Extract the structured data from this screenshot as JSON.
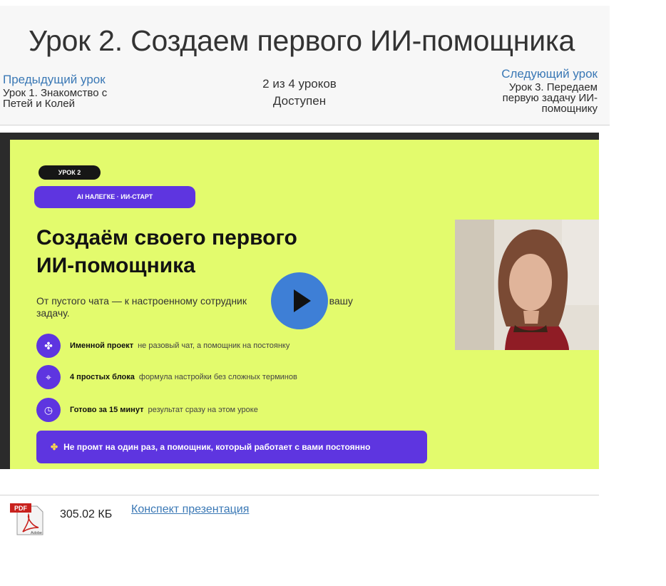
{
  "lesson": {
    "title": "Урок 2. Создаем первого ИИ-помощника"
  },
  "nav": {
    "prev_label": "Предыдущий урок",
    "prev_title_line1": "Урок 1. Знакомство с",
    "prev_title_line2": "Петей и Колей",
    "progress": "2 из 4 уроков",
    "status": "Доступен",
    "next_label": "Следующий урок",
    "next_title_line1": "Урок 3. Передаем",
    "next_title_line2": "первую задачу ИИ-",
    "next_title_line3": "помощнику"
  },
  "video": {
    "slide": {
      "badge": "УРОК 2",
      "course": "AI НАЛЕГКЕ · ИИ-СТАРТ",
      "title_line1": "Создаём своего первого",
      "title_line2": "ИИ-помощника",
      "desc": "От пустого чата — к настроенному сотрудник",
      "desc_tail": "знает вашу",
      "desc_line2": "задачу.",
      "features": [
        {
          "icon": "puzzle-icon",
          "glyph": "✤",
          "bold": "Именной проект",
          "rest": "не разовый чат, а помощник на постоянку"
        },
        {
          "icon": "compass-icon",
          "glyph": "⌖",
          "bold": "4 простых блока",
          "rest": "формула настройки без сложных терминов"
        },
        {
          "icon": "stopwatch-icon",
          "glyph": "◷",
          "bold": "Готово за 15 минут",
          "rest": "результат сразу на этом уроке"
        }
      ],
      "banner_glyph": "✤",
      "banner": "Не промт на один раз, а помощник, который работает с вами постоянно"
    },
    "colors": {
      "slide_bg": "#e3fb6d",
      "accent_purple": "#5e35e0",
      "play_button": "#3e7fd6"
    }
  },
  "attachment": {
    "icon": "pdf-file-icon",
    "pdf_tag": "PDF",
    "adobe_tag": "Adobe",
    "size": "305.02 КБ",
    "name": "Конспект презентация"
  }
}
